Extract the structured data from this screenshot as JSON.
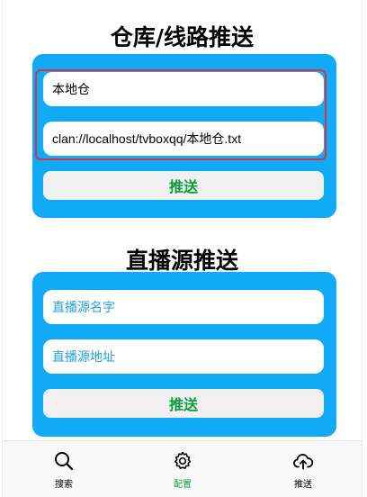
{
  "warehouse": {
    "title": "仓库/线路推送",
    "name_value": "本地仓",
    "url_value": "clan://localhost/tvboxqq/本地仓.txt",
    "push_label": "推送"
  },
  "live": {
    "title": "直播源推送",
    "name_placeholder": "直播源名字",
    "url_placeholder": "直播源地址",
    "push_label": "推送"
  },
  "nav": {
    "search_label": "搜索",
    "config_label": "配置",
    "push_label": "推送"
  },
  "colors": {
    "panel": "#10aaf6",
    "accent_green": "#0a9d3a",
    "highlight_red": "#d8323f",
    "placeholder": "#1ea3e0"
  },
  "icons": {
    "search": "search-icon",
    "config": "gear-icon",
    "push": "cloud-upload-icon"
  }
}
